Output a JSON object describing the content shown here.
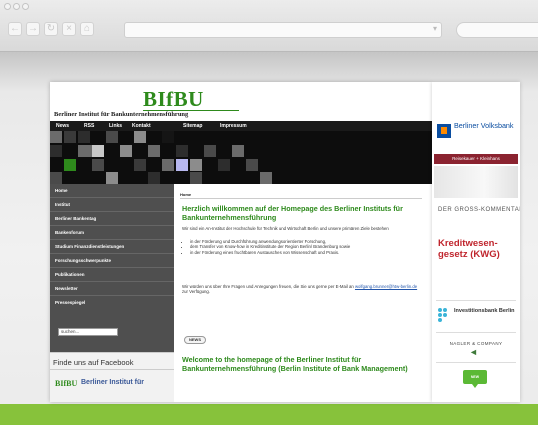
{
  "browser": {
    "nav_icons": [
      "back-icon",
      "forward-icon",
      "reload-icon",
      "stop-icon",
      "home-icon"
    ],
    "url": "",
    "search_placeholder": ""
  },
  "site": {
    "logo": "BIfBU",
    "subtitle": "Berliner Institut für Bankunternehmensführung",
    "topnav": [
      "News",
      "RSS",
      "Links",
      "Kontakt",
      "Sitemap",
      "Impressum"
    ],
    "sidebar": [
      "Home",
      "Institut",
      "Berliner Bankentag",
      "Bankenforum",
      "Studium Finanzdienstleistungen",
      "Forschungsschwerpunkte",
      "Publikationen",
      "Newsletter",
      "Pressespiegel"
    ],
    "search_value": "suchen...",
    "facebook": {
      "title": "Finde uns auf Facebook",
      "logo": "BIfBU",
      "name": "Berliner Institut für"
    },
    "main": {
      "breadcrumb": "Home",
      "welcome_de": "Herzlich willkommen auf der Homepage des Berliner Instituts für Bankunternehmensführung",
      "intro": "Wir sind ein An-Institut der Hochschule für Technik und Wirtschaft Berlin und unsere primären Ziele bestehen",
      "bullets": [
        "in der Förderung und Durchführung anwendungsorientierter Forschung,",
        "dem Transfer von Know-how in Kreditinstitute der Region Berlin/ Brandenburg sowie",
        "in der Förderung eines fruchtbaren Austausches von Wissenschaft und Praxis."
      ],
      "contact_text": "Wir würden uns über Ihre Fragen und Anregungen freuen, die Sie uns gerne per E-Mail an",
      "contact_email": "wolfgang.brunner@htw-berlin.de",
      "contact_tail": "zur Verfügung.",
      "news_button": "NEWS",
      "welcome_en": "Welcome to the homepage of the Berliner Institut für Bankunternehmensführung (Berlin Institute of Bank Management)"
    }
  },
  "ads": {
    "volksbank": "Berliner Volksbank",
    "volksbank_strip": "Reisekauer + Kleinhans",
    "gk_small": "DER GROSS-KOMMENTAR ZUM",
    "gk_big": "Kreditwesen-gesetz (KWG)",
    "ibb": "Investitionsbank Berlin",
    "nagler": "NAGLER & COMPANY",
    "bubble": "NEW"
  },
  "colors": {
    "green": "#2e8a1c",
    "page_green": "#87c23b",
    "sidebar": "#4f4f4f",
    "volksbank_blue": "#0a4da0"
  }
}
